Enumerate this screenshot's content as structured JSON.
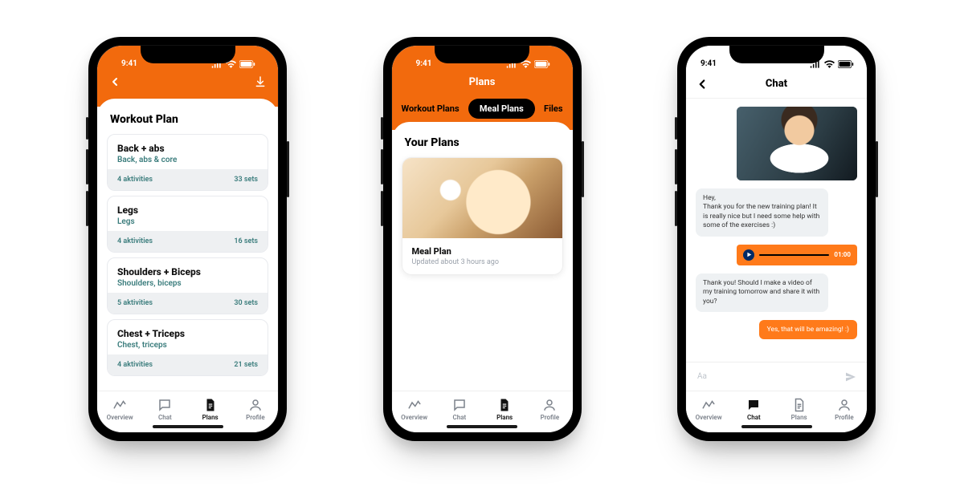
{
  "status": {
    "time": "9:41"
  },
  "colors": {
    "accent": "#f26a0d"
  },
  "nav": {
    "overview": "Overview",
    "chat": "Chat",
    "plans": "Plans",
    "profile": "Profile"
  },
  "phone1": {
    "section_title": "Workout Plan",
    "workouts": [
      {
        "name": "Back + abs",
        "sub": "Back, abs & core",
        "activities": "4 aktivities",
        "sets": "33 sets"
      },
      {
        "name": "Legs",
        "sub": "Legs",
        "activities": "4 aktivities",
        "sets": "16 sets"
      },
      {
        "name": "Shoulders + Biceps",
        "sub": "Shoulders, biceps",
        "activities": "5 aktivities",
        "sets": "30 sets"
      },
      {
        "name": "Chest + Triceps",
        "sub": "Chest, triceps",
        "activities": "4 aktivities",
        "sets": "21 sets"
      }
    ]
  },
  "phone2": {
    "header_title": "Plans",
    "tabs": {
      "workout": "Workout Plans",
      "meal": "Meal Plans",
      "files": "Files",
      "active": "meal"
    },
    "section_title": "Your Plans",
    "plan": {
      "name": "Meal Plan",
      "updated": "Updated about 3 hours ago"
    }
  },
  "phone3": {
    "header_title": "Chat",
    "msg1": "Hey,\nThank you for the new training plan! It is really nice but I need some help with some of the exercises :)",
    "audio_time": "01:00",
    "msg2": "Thank you! Should I make a video of my training tomorrow and share it with you?",
    "reply": "Yes, that will be amazing! :)",
    "input_placeholder": "Aa"
  }
}
